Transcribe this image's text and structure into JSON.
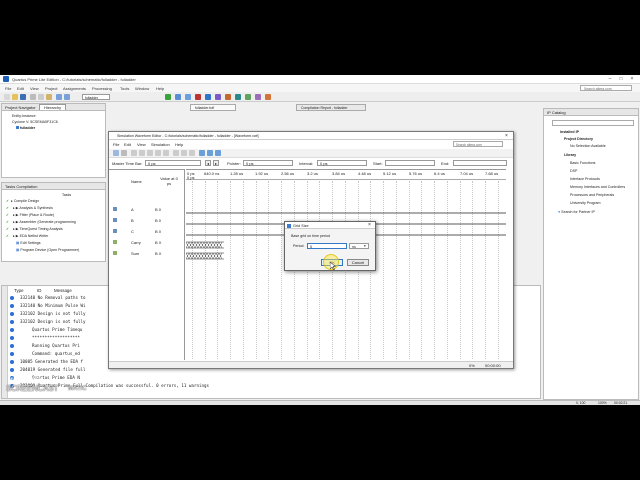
{
  "window": {
    "title": "Quartus Prime Lite Edition - C:/tutorials/schematic/fulladder - fulladder",
    "search_placeholder": "Search altera.com"
  },
  "menu": [
    "File",
    "Edit",
    "View",
    "Project",
    "Assignments",
    "Processing",
    "Tools",
    "Window",
    "Help"
  ],
  "toolbar": {
    "entity_select": "fulladder"
  },
  "doc_tabs": {
    "tab1": "fulladder.bdf",
    "tab2": "Compilation Report - fulladder"
  },
  "project_navigator": {
    "title": "Project Navigator",
    "view": "Hierarchy",
    "header": "Entity:Instance",
    "device": "Cyclone V: 5CSEMA5F31C6",
    "top": "fulladder"
  },
  "tasks": {
    "title": "Tasks",
    "panel_title": "Tasks Compilation",
    "items": [
      "Compile Design",
      "Analysis & Synthesis",
      "Fitter (Place & Route)",
      "Assembler (Generate programming",
      "TimeQuest Timing Analysis",
      "EDA Netlist Writer",
      "Edit Settings",
      "Program Device (Open Programmer)"
    ]
  },
  "messages": {
    "header_type": "Type",
    "header_id": "ID",
    "header_message": "Message",
    "lines": [
      "332140 No Removal paths to",
      "332140 No Minimum Pulse Wi",
      "332102 Design is not fully",
      "332102 Design is not fully",
      "Quartus Prime Timequ",
      "*******************",
      "Running Quartus Pri",
      "Command: quartus_ed",
      "10005 Generated the EDA f",
      "204019 Generated file full",
      "Quartus Prime EDA N",
      "293000 Quartus Prime Full Compilation was successful. 0 errors, 11 warnings"
    ]
  },
  "ip_catalog": {
    "title": "IP Catalog",
    "installed": "Installed IP",
    "project_dir": "Project Directory",
    "no_selection": "No Selection Available",
    "library": "Library",
    "items": [
      "Basic Functions",
      "DSP",
      "Interface Protocols",
      "Memory Interfaces and Controllers",
      "Processors and Peripherals",
      "University Program"
    ],
    "search_partner": "Search for Partner IP"
  },
  "waveform": {
    "title": "Simulation Waveform Editor - C:/tutorials/schematic/fulladder - fulladder - [Waveform.vwf]",
    "menu": [
      "File",
      "Edit",
      "View",
      "Simulation",
      "Help"
    ],
    "search": "Search altera.com",
    "master_time_bar_label": "Master Time Bar:",
    "master_time_bar_value": "0 ps",
    "pointer_label": "Pointer:",
    "pointer_value": "0 ps",
    "interval_label": "Interval:",
    "interval_value": "0 ps",
    "start_label": "Start:",
    "end_label": "End:",
    "col_name": "Name",
    "col_value": "Value at 0 ps",
    "time_labels": [
      "0 ps",
      "640.0 ns",
      "1.28 us",
      "1.92 us",
      "2.56 us",
      "3.2 us",
      "3.84 us",
      "4.48 us",
      "5.12 us",
      "5.76 us",
      "6.4 us",
      "7.04 us",
      "7.68 us"
    ],
    "time_origin": "0 ps",
    "signals": [
      {
        "name": "A",
        "value": "B 0"
      },
      {
        "name": "B",
        "value": "B 0"
      },
      {
        "name": "C",
        "value": "B 0"
      },
      {
        "name": "Carry",
        "value": "B X"
      },
      {
        "name": "Sum",
        "value": "B X"
      }
    ],
    "status_percent": "0%",
    "status_time": "00:00:00"
  },
  "dialog": {
    "title": "Grid Size",
    "caption": "Base grid on time period",
    "period_label": "Period:",
    "period_value": "5",
    "unit": "ns",
    "ok": "OK",
    "cancel": "Cancel"
  },
  "statusbar": {
    "coords": "0, 100",
    "zoom": "100%",
    "time": "00:02:21"
  },
  "watermark": {
    "line1": "RECORDED WITH",
    "line2": "SCREENCAST",
    "line3": "MATIC"
  }
}
